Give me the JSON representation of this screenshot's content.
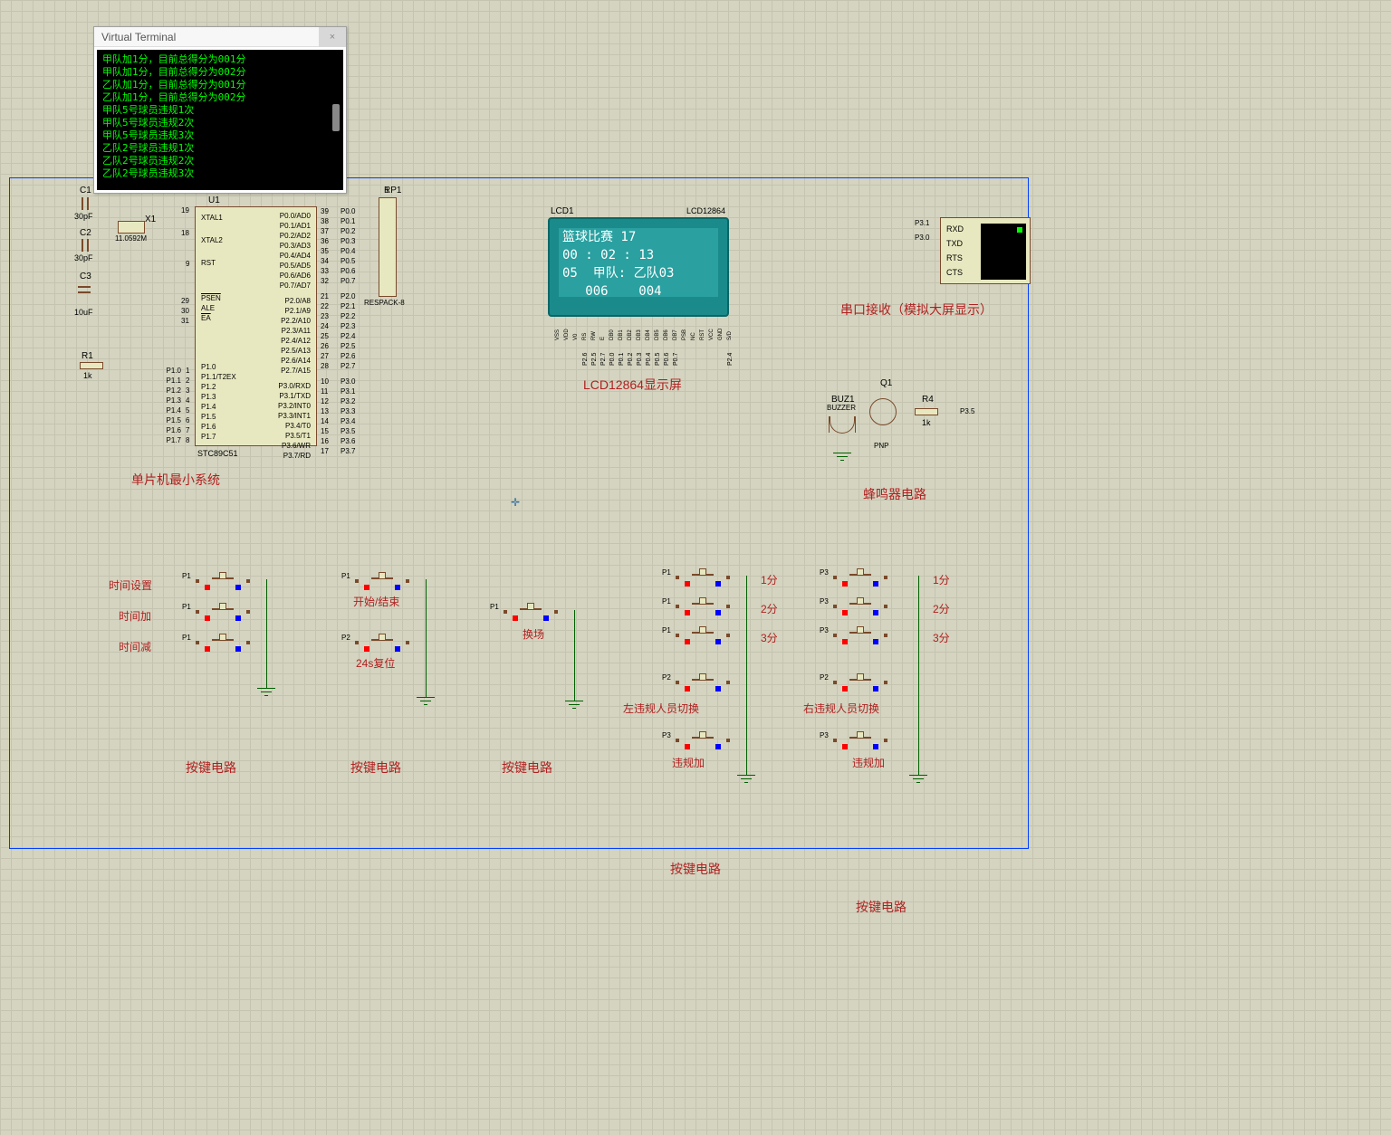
{
  "terminal": {
    "title": "Virtual Terminal",
    "lines": [
      "甲队加1分，目前总得分为001分",
      "甲队加1分，目前总得分为002分",
      "乙队加1分，目前总得分为001分",
      "乙队加1分，目前总得分为002分",
      "甲队5号球员违规1次",
      "甲队5号球员违规2次",
      "甲队5号球员违规3次",
      "乙队2号球员违规1次",
      "乙队2号球员违规2次",
      "乙队2号球员违规3次"
    ]
  },
  "mcu": {
    "ref": "U1",
    "part": "STC89C51",
    "section_label": "单片机最小系统",
    "left_top_pins": [
      "XTAL1",
      "XTAL2",
      "RST",
      "PSEN",
      "ALE",
      "EA"
    ],
    "left_top_nums": [
      "19",
      "18",
      "9",
      "29",
      "30",
      "31"
    ],
    "left_bot": [
      {
        "n": "1",
        "name": "P1.0"
      },
      {
        "n": "2",
        "name": "P1.1/T2EX"
      },
      {
        "n": "3",
        "name": "P1.2"
      },
      {
        "n": "4",
        "name": "P1.3"
      },
      {
        "n": "5",
        "name": "P1.4"
      },
      {
        "n": "6",
        "name": "P1.5"
      },
      {
        "n": "7",
        "name": "P1.6"
      },
      {
        "n": "8",
        "name": "P1.7"
      }
    ],
    "right_top": [
      {
        "n": "39",
        "name": "P0.0/AD0"
      },
      {
        "n": "38",
        "name": "P0.1/AD1"
      },
      {
        "n": "37",
        "name": "P0.2/AD2"
      },
      {
        "n": "36",
        "name": "P0.3/AD3"
      },
      {
        "n": "35",
        "name": "P0.4/AD4"
      },
      {
        "n": "34",
        "name": "P0.5/AD5"
      },
      {
        "n": "33",
        "name": "P0.6/AD6"
      },
      {
        "n": "32",
        "name": "P0.7/AD7"
      }
    ],
    "right_mid": [
      {
        "n": "21",
        "name": "P2.0/A8"
      },
      {
        "n": "22",
        "name": "P2.1/A9"
      },
      {
        "n": "23",
        "name": "P2.2/A10"
      },
      {
        "n": "24",
        "name": "P2.3/A11"
      },
      {
        "n": "25",
        "name": "P2.4/A12"
      },
      {
        "n": "26",
        "name": "P2.5/A13"
      },
      {
        "n": "27",
        "name": "P2.6/A14"
      },
      {
        "n": "28",
        "name": "P2.7/A15"
      }
    ],
    "right_bot": [
      {
        "n": "10",
        "name": "P3.0/RXD"
      },
      {
        "n": "11",
        "name": "P3.1/TXD"
      },
      {
        "n": "12",
        "name": "P3.2/INT0"
      },
      {
        "n": "13",
        "name": "P3.3/INT1"
      },
      {
        "n": "14",
        "name": "P3.4/T0"
      },
      {
        "n": "15",
        "name": "P3.5/T1"
      },
      {
        "n": "16",
        "name": "P3.6/WR"
      },
      {
        "n": "17",
        "name": "P3.7/RD"
      }
    ],
    "ext_left_p1": [
      "P1.0",
      "P1.1",
      "P1.2",
      "P1.3",
      "P1.4",
      "P1.5",
      "P1.6",
      "P1.7"
    ],
    "ext_right_p0": [
      "P0.0",
      "P0.1",
      "P0.2",
      "P0.3",
      "P0.4",
      "P0.5",
      "P0.6",
      "P0.7"
    ],
    "ext_right_p2": [
      "P2.0",
      "P2.1",
      "P2.2",
      "P2.3",
      "P2.4",
      "P2.5",
      "P2.6",
      "P2.7"
    ],
    "ext_right_p3": [
      "P3.0",
      "P3.1",
      "P3.2",
      "P3.3",
      "P3.4",
      "P3.5",
      "P3.6",
      "P3.7"
    ]
  },
  "crystal": {
    "ref": "X1",
    "val": "11.0592M"
  },
  "caps": {
    "c1": {
      "ref": "C1",
      "val": "30pF"
    },
    "c2": {
      "ref": "C2",
      "val": "30pF"
    },
    "c3": {
      "ref": "C3",
      "val": "10uF"
    }
  },
  "res": {
    "r1": {
      "ref": "R1",
      "val": "1k"
    },
    "r4": {
      "ref": "R4",
      "val": "1k"
    }
  },
  "respack": {
    "ref": "RP1",
    "part": "RESPACK-8",
    "pin1": "1"
  },
  "lcd": {
    "ref": "LCD1",
    "part": "LCD12864",
    "label": "LCD12864显示屏",
    "line1": "篮球比赛 17",
    "line2": "00 : 02 : 13",
    "line3": "05  甲队: 乙队03",
    "line4": "   006    004",
    "pins": [
      "VSS",
      "VDD",
      "V0",
      "RS",
      "RW",
      "E",
      "DB0",
      "DB1",
      "DB2",
      "DB3",
      "DB4",
      "DB5",
      "DB6",
      "DB7",
      "PSB",
      "NC",
      "RST",
      "VCC",
      "GND",
      "S/D"
    ],
    "pin_nets": [
      "",
      "",
      "",
      "P2.6",
      "P2.5",
      "P2.7",
      "P0.0",
      "P0.1",
      "P0.2",
      "P0.3",
      "P0.4",
      "P0.5",
      "P0.6",
      "P0.7",
      "",
      "",
      "",
      "",
      "",
      "P2.4"
    ]
  },
  "serial": {
    "label": "串口接收（模拟大屏显示）",
    "pins": [
      "RXD",
      "TXD",
      "RTS",
      "CTS"
    ],
    "nets": [
      "P3.1",
      "P3.0"
    ]
  },
  "buzzer": {
    "ref": "BUZ1",
    "part": "BUZZER",
    "label": "蜂鸣器电路",
    "q": "Q1",
    "qtype": "PNP",
    "net": "P3.5"
  },
  "btn_groups": {
    "time": {
      "label": "按键电路",
      "items": [
        "时间设置",
        "时间加",
        "时间减"
      ],
      "pins": [
        "P1",
        "P1",
        "P1"
      ]
    },
    "startend": {
      "label": "按键电路",
      "items": [
        "开始/结束",
        "24s复位"
      ],
      "pins": [
        "P1",
        "P2"
      ]
    },
    "swap": {
      "label": "按键电路",
      "items": [
        "换场"
      ],
      "pins": [
        "P1"
      ]
    },
    "left_score": {
      "label": "按键电路",
      "items": [
        "1分",
        "2分",
        "3分"
      ],
      "pins": [
        "P1",
        "P1",
        "P1"
      ],
      "extra1": "左违规人员切换",
      "extra1_pin": "P2",
      "extra2": "违规加",
      "extra2_pin": "P3"
    },
    "right_score": {
      "label": "按键电路",
      "items": [
        "1分",
        "2分",
        "3分"
      ],
      "pins": [
        "P3",
        "P3",
        "P3"
      ],
      "extra1": "右违规人员切换",
      "extra1_pin": "P2",
      "extra2": "违规加",
      "extra2_pin": "P3"
    }
  }
}
